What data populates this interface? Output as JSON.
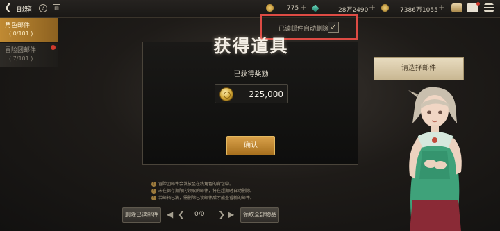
{
  "header": {
    "back_icon": "back-arrow-icon",
    "title": "邮箱",
    "help_icon": "help-icon",
    "calendar_icon": "calendar-icon",
    "currencies": [
      {
        "icon": "gold-coin-icon",
        "value": "775",
        "color": "#c9a04a"
      },
      {
        "icon": "gem-icon",
        "value": "28万2490",
        "color": "#3fb8a0"
      },
      {
        "icon": "coin-icon",
        "value": "7386万1055",
        "color": "#d2a43c"
      }
    ],
    "right_icons": [
      "cake-icon",
      "mail-icon",
      "menu-icon"
    ]
  },
  "auto_delete": {
    "label": "已读邮件自动删除",
    "checked": true,
    "highlight_color": "#dd4b44"
  },
  "sidebar": {
    "tabs": [
      {
        "label": "角色邮件",
        "count": "( 0/101 )",
        "active": true
      },
      {
        "label": "冒险团邮件",
        "count": "( 7/101 )",
        "active": false,
        "has_dot": true
      }
    ]
  },
  "modal": {
    "title": "获得道具",
    "subtitle": "已获得奖励",
    "reward": {
      "icon": "gold-coin-icon",
      "amount": "225,000"
    },
    "confirm_label": "确认"
  },
  "right_panel": {
    "select_mail_label": "请选择邮件"
  },
  "notes": [
    "冒险团邮件会发放至在线角色的背包中。",
    "未在保存期限内领取的邮件，将在超期时自动删除。",
    "若邮箱已满，需删除已读邮件后才能查看新的邮件。"
  ],
  "footer": {
    "delete_read_label": "删除已读邮件",
    "page_info": "0/0",
    "claim_all_label": "领取全部物品"
  },
  "colors": {
    "accent_gold": "#c08a33",
    "highlight_red": "#dd4b44"
  }
}
